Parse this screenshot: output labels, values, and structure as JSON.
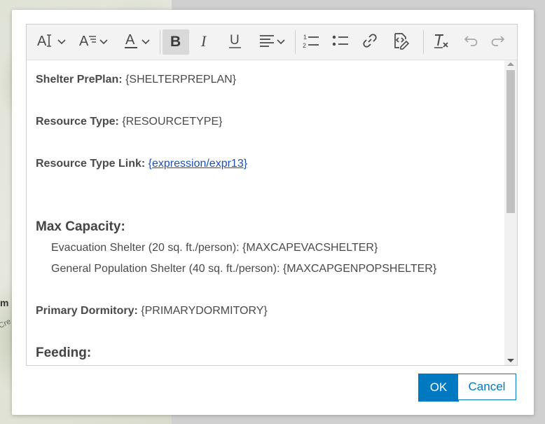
{
  "map": {
    "label_a": "m",
    "label_b": "Cre"
  },
  "toolbar": {
    "buttons": [
      {
        "name": "font-size",
        "icon": "font-size-icon"
      },
      {
        "name": "heading",
        "icon": "heading-icon"
      },
      {
        "name": "font-color",
        "icon": "font-color-icon"
      },
      {
        "name": "bold",
        "icon": "bold-icon",
        "active": true
      },
      {
        "name": "italic",
        "icon": "italic-icon"
      },
      {
        "name": "underline",
        "icon": "underline-icon"
      },
      {
        "name": "align",
        "icon": "align-left-icon"
      },
      {
        "name": "numbered-list",
        "icon": "numbered-list-icon"
      },
      {
        "name": "bulleted-list",
        "icon": "bulleted-list-icon"
      },
      {
        "name": "link",
        "icon": "link-icon"
      },
      {
        "name": "insert-expression",
        "icon": "expression-icon"
      },
      {
        "name": "clear-formatting",
        "icon": "clear-format-icon"
      },
      {
        "name": "undo",
        "icon": "undo-icon",
        "disabled": true
      },
      {
        "name": "redo",
        "icon": "redo-icon",
        "disabled": true
      }
    ]
  },
  "content": {
    "shelter_label": "Shelter PrePlan:",
    "shelter_value": "{SHELTERPREPLAN}",
    "resource_type_label": "Resource Type:",
    "resource_type_value": "{RESOURCETYPE}",
    "resource_link_label": "Resource Type Link:",
    "resource_link_value": "{expression/expr13}",
    "max_capacity_heading": "Max Capacity:",
    "evac_line": "Evacuation Shelter (20 sq. ft./person): {MAXCAPEVACSHELTER}",
    "genpop_line": "General Population Shelter (40 sq. ft./person): {MAXCAPGENPOPSHELTER}",
    "dormitory_label": "Primary Dormitory:",
    "dormitory_value": "{PRIMARYDORMITORY}",
    "feeding_heading": "Feeding:"
  },
  "actions": {
    "ok_label": "OK",
    "cancel_label": "Cancel"
  },
  "colors": {
    "accent": "#0079c1",
    "link": "#1c4fb5",
    "text": "#4a4a4a"
  }
}
